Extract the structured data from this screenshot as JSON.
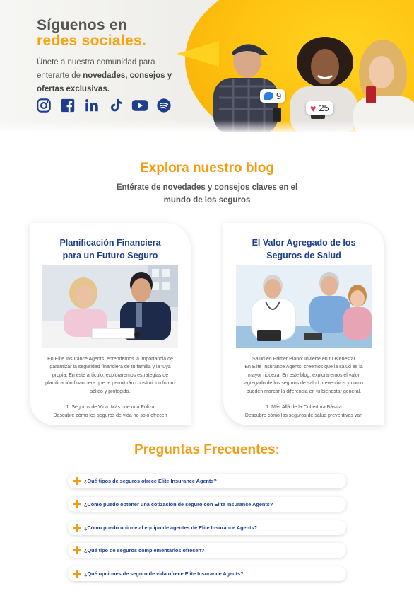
{
  "hero": {
    "title_line1": "Síguenos en",
    "title_line2": "redes sociales.",
    "subtitle_prefix": "Únete a nuestra comunidad para enterarte de ",
    "subtitle_bold": "novedades, consejos y ofertas exclusivas.",
    "social_icons": [
      "instagram-icon",
      "facebook-icon",
      "linkedin-icon",
      "tiktok-icon",
      "youtube-icon",
      "spotify-icon"
    ],
    "comment_count": "9",
    "like_count": "25",
    "colors": {
      "accent": "#f7a30c",
      "blob": "#ffc412",
      "icons": "#1d3e8f"
    }
  },
  "blog": {
    "title": "Explora nuestro blog",
    "subtitle": "Entérate de novedades y consejos claves en el mundo de los seguros",
    "cards": [
      {
        "title_line1": "Planificación Financiera",
        "title_line2": "para un Futuro Seguro",
        "paragraph": "En Elite Insurance Agents, entendemos la importancia de garantizar la seguridad financiera de tu familia y la tuya propia. En este artículo, exploraremos estrategias de planificación financiera que te permitirán construir un futuro sólido y protegido.",
        "section_line1": "1. Seguros de Vida: Más que una Póliza",
        "section_line2": "Descubre cómo los seguros de vida no solo ofrecen"
      },
      {
        "title_line1": "El Valor Agregado de los",
        "title_line2": "Seguros de Salud",
        "paragraph_heading": "Salud en Primer Plano: Invierte en tu Bienestar",
        "paragraph": "En Elite Insurance Agents, creemos que la salud es la mayor riqueza. En este blog, exploraremos el valor agregado de los seguros de salud preventivos y cómo pueden marcar la diferencia en tu bienestar general.",
        "section_line1": "1. Más Allá de la Cobertura Básica",
        "section_line2": "Descubre cómo los seguros de salud preventivos van"
      }
    ],
    "colors": {
      "title": "#f39c12",
      "card_title": "#1d3e8f"
    }
  },
  "faq": {
    "title": "Preguntas Frecuentes:",
    "items": [
      "¿Qué tipos de seguros ofrece Elite Insurance Agents?",
      "¿Cómo puedo obtener una cotización de seguro con Elite Insurance Agents?",
      "¿Cómo puedo unirme al equipo de agentes de Elite Insurance Agents?",
      "¿Qué tipo de seguros complementarios ofrecen?",
      "¿Qué opciones de seguro de vida ofrece Elite Insurance Agents?"
    ]
  }
}
